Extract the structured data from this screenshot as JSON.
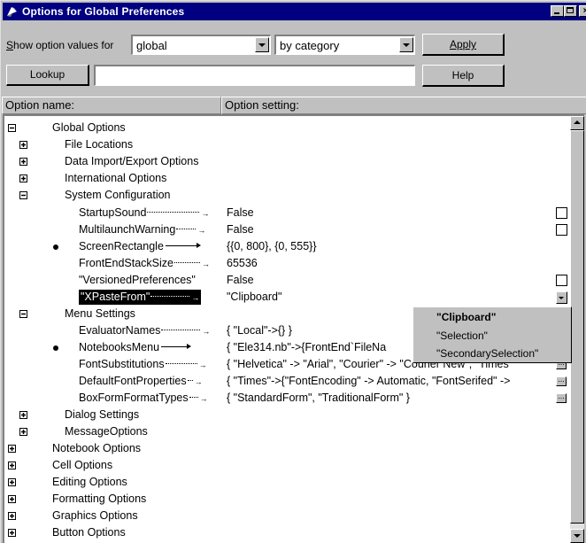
{
  "window": {
    "title": "Options for Global Preferences",
    "app_icon": "mathematica-icon",
    "controls": {
      "minimize": "minimize-icon",
      "maximize": "maximize-icon",
      "close": "close-icon"
    }
  },
  "toolbar": {
    "show_label": "Show option values for",
    "scope_value": "global",
    "group_value": "by category",
    "apply_label": "Apply",
    "lookup_label": "Lookup",
    "lookup_value": "",
    "help_label": "Help"
  },
  "columns": {
    "name": "Option name:",
    "setting": "Option setting:"
  },
  "tree": {
    "global_options": "Global Options",
    "file_locations": "File Locations",
    "data_import_export": "Data Import/Export Options",
    "international": "International Options",
    "system_configuration": "System Configuration",
    "startup_sound": {
      "name": "StartupSound",
      "value": "False"
    },
    "multilaunch_warning": {
      "name": "MultilaunchWarning",
      "value": "False"
    },
    "screen_rectangle": {
      "name": "ScreenRectangle",
      "value": "{{0, 800}, {0, 555}}"
    },
    "front_end_stack_size": {
      "name": "FrontEndStackSize",
      "value": "65536"
    },
    "versioned_preferences": {
      "name": "\"VersionedPreferences\"",
      "value": "False"
    },
    "xpaste_from": {
      "name": "\"XPasteFrom\"",
      "value": "\"Clipboard\""
    },
    "menu_settings": "Menu Settings",
    "evaluator_names": {
      "name": "EvaluatorNames",
      "value": "{ \"Local\"->{} }"
    },
    "notebooks_menu": {
      "name": "NotebooksMenu",
      "value": "{ \"Ele314.nb\"->{FrontEnd`FileNa"
    },
    "font_substitutions": {
      "name": "FontSubstitutions",
      "value": "{ \"Helvetica\" -> \"Arial\", \"Courier\" -> \"Courier New\", \"Times\""
    },
    "default_font_properties": {
      "name": "DefaultFontProperties",
      "value": "{ \"Times\"->{\"FontEncoding\" -> Automatic, \"FontSerifed\" ->"
    },
    "box_form_format_types": {
      "name": "BoxFormFormatTypes",
      "value": "{ \"StandardForm\", \"TraditionalForm\" }"
    },
    "dialog_settings": "Dialog Settings",
    "message_options": "MessageOptions",
    "notebook_options": "Notebook Options",
    "cell_options": "Cell Options",
    "editing_options": "Editing Options",
    "formatting_options": "Formatting Options",
    "graphics_options": "Graphics Options",
    "button_options": "Button Options"
  },
  "dropdown": {
    "options": [
      "\"Clipboard\"",
      "\"Selection\"",
      "\"SecondarySelection\""
    ]
  }
}
